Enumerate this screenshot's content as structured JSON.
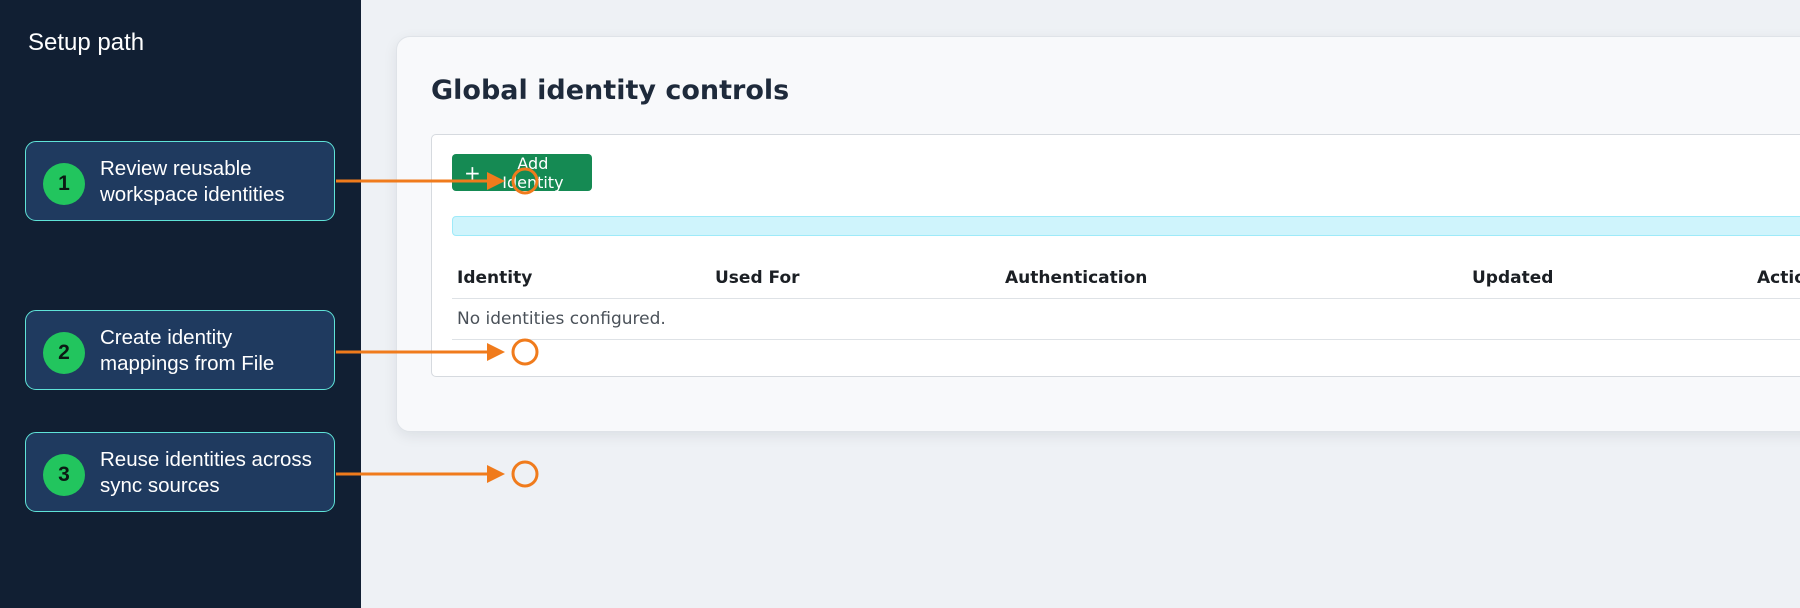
{
  "sidebar": {
    "title": "Setup path",
    "steps": [
      {
        "number": "1",
        "label": "Review reusable workspace identities"
      },
      {
        "number": "2",
        "label": "Create identity mappings from File"
      },
      {
        "number": "3",
        "label": "Reuse identities across sync sources"
      }
    ]
  },
  "main": {
    "title": "Global identity controls",
    "add_button": {
      "icon": "plus-icon",
      "label": "Add Identity"
    },
    "table": {
      "columns": [
        "Identity",
        "Used For",
        "Authentication",
        "Updated",
        "Actions"
      ],
      "empty_text": "No identities configured."
    }
  },
  "colors": {
    "sidebar_bg": "#111f33",
    "step_card_bg": "#1f3a5f",
    "step_card_border": "#5fe3d8",
    "step_badge": "#22c55e",
    "arrow": "#f07b1c",
    "primary_button": "#158a53",
    "info_bar": "#cff4fc"
  }
}
